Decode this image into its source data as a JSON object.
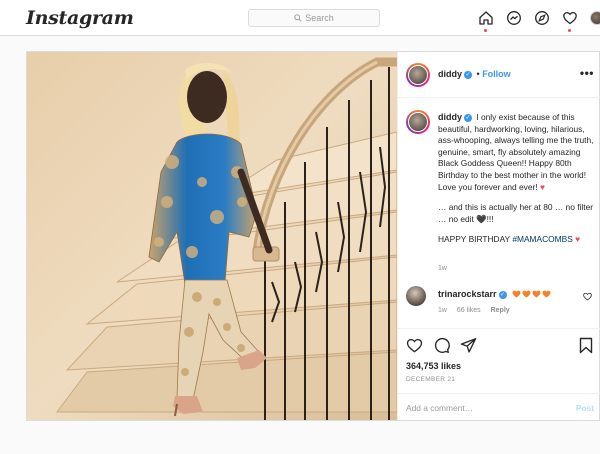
{
  "app": {
    "logo": "Instagram"
  },
  "search": {
    "placeholder": "Search"
  },
  "nav": {
    "icons": [
      "home-icon",
      "messenger-icon",
      "explore-icon",
      "activity-heart-icon",
      "profile-avatar"
    ]
  },
  "post": {
    "author": "diddy",
    "follow_label": "Follow",
    "more_label": "•••",
    "caption": {
      "author": "diddy",
      "text1": "I only exist because of this beautiful, hardworking, loving, hilarious, ass-whooping, always telling me the truth, genuine, smart, fly absolutely amazing Black Goddess Queen!! Happy 80th Birthday to the best mother in the world! Love you forever and ever! ",
      "text2": "… and this is actually her at 80 … no filter … no edit 🖤!!!",
      "text3": "HAPPY BIRTHDAY ",
      "hashtag": "#MAMACOMBS",
      "heart": "♥",
      "time": "1w"
    },
    "comment": {
      "author": "trinarockstarr",
      "time": "1w",
      "likes": "66 likes",
      "reply": "Reply"
    },
    "likes": "364,753 likes",
    "date": "DECEMBER 21",
    "add_comment_placeholder": "Add a comment…",
    "post_button": "Post"
  },
  "colors": {
    "accent": "#3897f0",
    "heart": "#ed4956",
    "border": "#dbdbdb"
  }
}
